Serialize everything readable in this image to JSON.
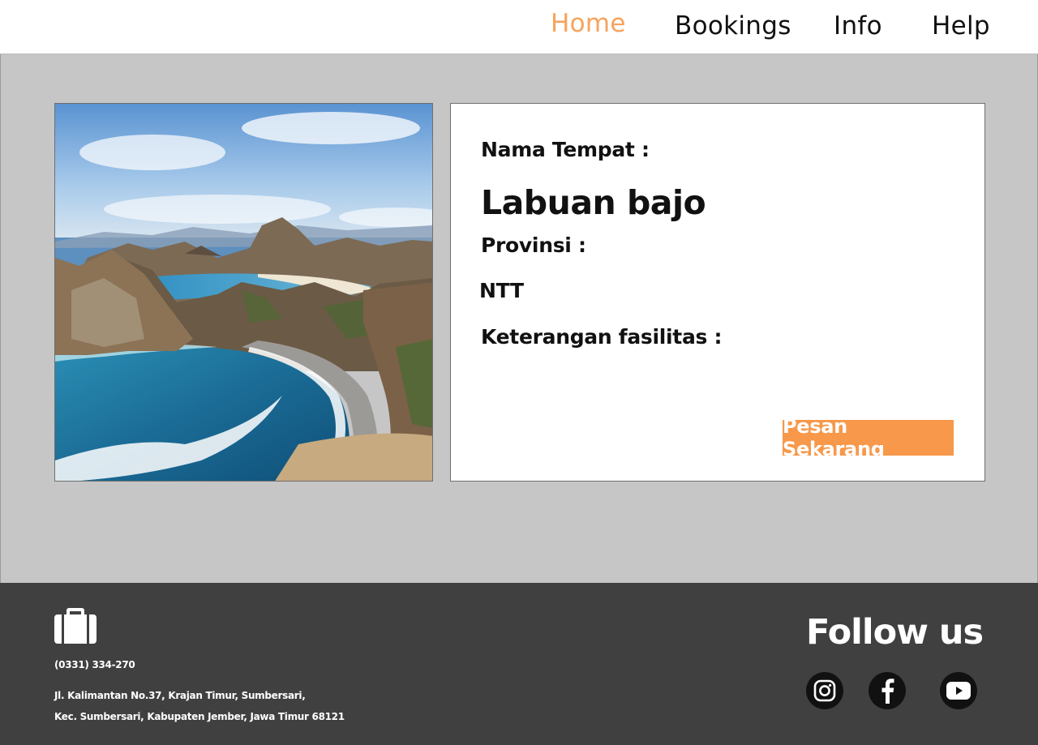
{
  "nav": {
    "items": [
      {
        "label": "Home",
        "active": true
      },
      {
        "label": "Bookings",
        "active": false
      },
      {
        "label": "Info",
        "active": false
      },
      {
        "label": "Help",
        "active": false
      }
    ]
  },
  "detail": {
    "name_label": "Nama Tempat :",
    "name_value": "Labuan bajo",
    "province_label": "Provinsi :",
    "province_value": "NTT",
    "facilities_label": "Keterangan fasilitas :",
    "book_button": "Pesan Sekarang"
  },
  "footer": {
    "icon": "briefcase-icon",
    "phone": "(0331) 334-270",
    "address_line1": "Jl. Kalimantan No.37, Krajan Timur, Sumbersari,",
    "address_line2": "Kec. Sumbersari, Kabupaten Jember, Jawa Timur 68121",
    "follow_title": "Follow us",
    "social": [
      "instagram-icon",
      "facebook-icon",
      "youtube-icon"
    ]
  },
  "colors": {
    "accent": "#f7a35c",
    "button": "#f7984a",
    "page_bg": "#c6c6c6",
    "footer_bg": "#404040"
  }
}
